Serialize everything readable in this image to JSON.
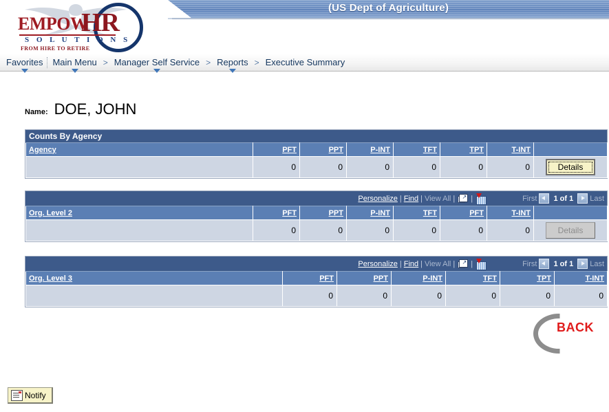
{
  "header": {
    "agency_title": "(US Dept of Agriculture)",
    "logo": {
      "word_empow": "EMPOW",
      "word_hr": "HR",
      "tagline_solutions": "S O L U T I O N S",
      "tagline_hire": "FROM HIRE TO RETIRE"
    }
  },
  "breadcrumb": {
    "items": [
      {
        "label": "Favorites",
        "has_dropdown": true
      },
      {
        "label": "Main Menu",
        "has_dropdown": true
      },
      {
        "label": "Manager Self Service",
        "has_dropdown": true
      },
      {
        "label": "Reports",
        "has_dropdown": true
      },
      {
        "label": "Executive Summary",
        "has_dropdown": false
      }
    ],
    "separator": ">"
  },
  "employee": {
    "name_label": "Name:",
    "name_value": "DOE, JOHN"
  },
  "nav_toolbar": {
    "personalize": "Personalize",
    "find": "Find",
    "view_all": "View All",
    "separator": "|",
    "zoom_icon": "expand-grid-icon",
    "spreadsheet_icon": "download-spreadsheet-icon",
    "first": "First",
    "page_count": "1 of 1",
    "last": "Last"
  },
  "grids": [
    {
      "title": "Counts By Agency",
      "show_navbar": false,
      "columns": [
        "Agency",
        "PFT",
        "PPT",
        "P-INT",
        "TFT",
        "TPT",
        "T-INT"
      ],
      "row_values": [
        "",
        "0",
        "0",
        "0",
        "0",
        "0",
        "0"
      ],
      "details_label": "Details",
      "details_state": "focused"
    },
    {
      "title": "",
      "show_navbar": true,
      "columns": [
        "Org. Level 2",
        "PFT",
        "PPT",
        "P-INT",
        "TFT",
        "PFT",
        "T-INT"
      ],
      "row_values": [
        "",
        "0",
        "0",
        "0",
        "0",
        "0",
        "0"
      ],
      "details_label": "Details",
      "details_state": "disabled"
    },
    {
      "title": "",
      "show_navbar": true,
      "columns": [
        "Org. Level 3",
        "PFT",
        "PPT",
        "P-INT",
        "TFT",
        "TPT",
        "T-INT"
      ],
      "row_values": [
        "",
        "0",
        "0",
        "0",
        "0",
        "0",
        "0"
      ],
      "details_label": "",
      "details_state": "none"
    }
  ],
  "back_button": {
    "label": "BACK"
  },
  "notify_button": {
    "label": "Notify"
  }
}
